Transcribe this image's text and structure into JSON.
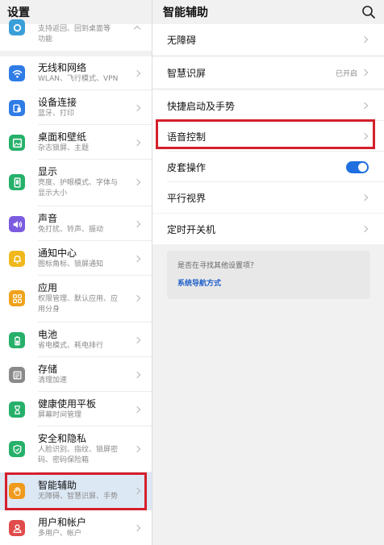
{
  "left": {
    "title": "设置",
    "items": [
      {
        "title": "",
        "sub": "支持返回、回到桌面等",
        "sub2": "功能",
        "color": "#3a9fd8",
        "icon": "dot-icon"
      },
      {
        "title": "无线和网络",
        "sub": "WLAN、飞行模式、VPN",
        "color": "#2f7ce6",
        "icon": "wifi-icon"
      },
      {
        "title": "设备连接",
        "sub": "蓝牙、打印",
        "color": "#2f7ce6",
        "icon": "device-icon"
      },
      {
        "title": "桌面和壁纸",
        "sub": "杂志锁屏、主题",
        "color": "#26b06a",
        "icon": "picture-icon"
      },
      {
        "title": "显示",
        "sub": "亮度、护眼模式、字体与",
        "sub2": "显示大小",
        "color": "#26b06a",
        "icon": "phone-icon"
      },
      {
        "title": "声音",
        "sub": "免打扰、铃声、振动",
        "color": "#7b5be0",
        "icon": "speaker-icon"
      },
      {
        "title": "通知中心",
        "sub": "图标角标、锁屏通知",
        "color": "#f0b81c",
        "icon": "bell-icon"
      },
      {
        "title": "应用",
        "sub": "权限管理、默认应用、应",
        "sub2": "用分身",
        "color": "#f0a21c",
        "icon": "grid-icon"
      },
      {
        "title": "电池",
        "sub": "省电模式、耗电排行",
        "color": "#26b06a",
        "icon": "battery-icon"
      },
      {
        "title": "存储",
        "sub": "清理加速",
        "color": "#8a8a8a",
        "icon": "storage-icon"
      },
      {
        "title": "健康使用平板",
        "sub": "屏幕时间管理",
        "color": "#26b06a",
        "icon": "hourglass-icon"
      },
      {
        "title": "安全和隐私",
        "sub": "人脸识别、指纹、锁屏密",
        "sub2": "码、密码保险箱",
        "color": "#26b06a",
        "icon": "shield-icon"
      },
      {
        "title": "智能辅助",
        "sub": "无障碍、智慧识屏、手势",
        "color": "#f09a1c",
        "icon": "hand-icon"
      },
      {
        "title": "用户和帐户",
        "sub": "多用户、帐户",
        "color": "#e04b4b",
        "icon": "user-icon"
      }
    ]
  },
  "right": {
    "title": "智能辅助",
    "search_icon": "search-icon",
    "rows": {
      "accessibility": "无障碍",
      "smart_screen": "智慧识屏",
      "smart_screen_status": "已开启",
      "shortcuts": "快捷启动及手势",
      "voice_control": "语音控制",
      "cover_operation": "皮套操作",
      "cover_toggle": "on",
      "parallel_view": "平行视界",
      "scheduled_power": "定时开关机"
    },
    "hint": {
      "question": "是否在寻找其他设置项？",
      "link": "系统导航方式"
    }
  },
  "colors": {
    "highlight": "#d4202c",
    "accent": "#1f6fe0",
    "selected_bg": "#dde8f5"
  }
}
